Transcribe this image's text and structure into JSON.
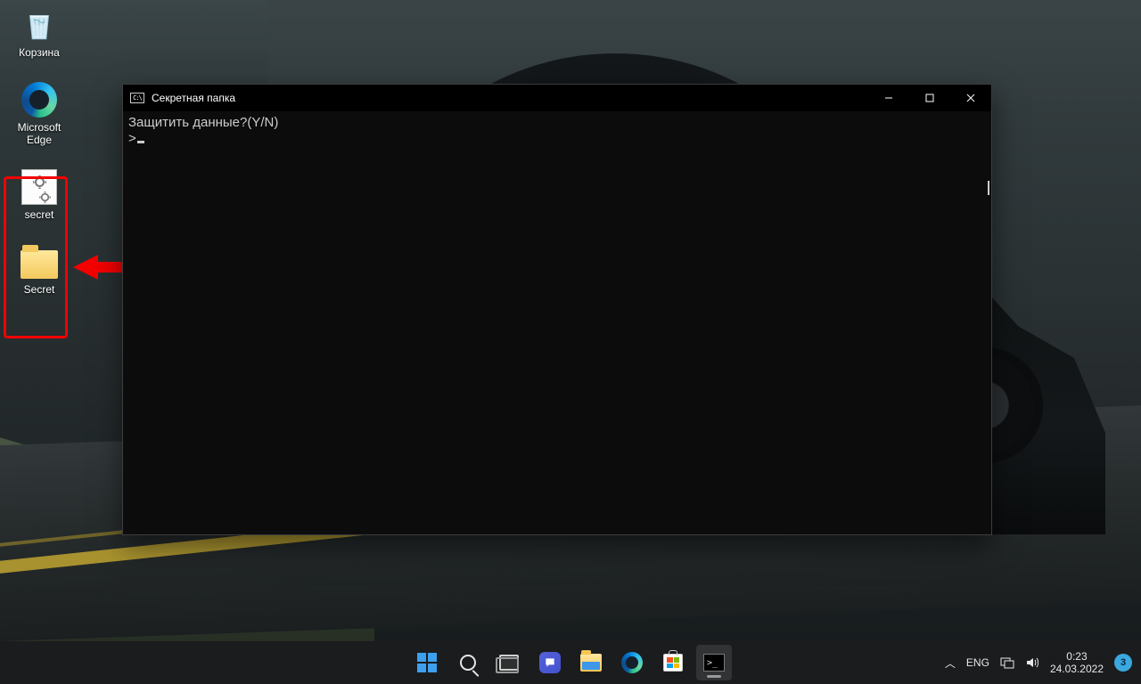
{
  "desktop": {
    "icons": [
      {
        "id": "recycle-bin",
        "label": "Корзина"
      },
      {
        "id": "edge",
        "label": "Microsoft\nEdge"
      },
      {
        "id": "secret-bat",
        "label": "secret"
      },
      {
        "id": "secret-folder",
        "label": "Secret"
      }
    ]
  },
  "console": {
    "title": "Секретная папка",
    "line1": "Защитить данные?(Y/N)",
    "prompt": ">"
  },
  "taskbar": {
    "items": [
      {
        "id": "start",
        "name": "start-button"
      },
      {
        "id": "search",
        "name": "search-button"
      },
      {
        "id": "task-view",
        "name": "task-view-button"
      },
      {
        "id": "chat",
        "name": "chat-button"
      },
      {
        "id": "explorer",
        "name": "file-explorer-button"
      },
      {
        "id": "edge",
        "name": "edge-button"
      },
      {
        "id": "store",
        "name": "microsoft-store-button"
      },
      {
        "id": "terminal",
        "name": "terminal-button",
        "active": true
      }
    ]
  },
  "tray": {
    "language": "ENG",
    "time": "0:23",
    "date": "24.03.2022",
    "notification_count": "3"
  }
}
